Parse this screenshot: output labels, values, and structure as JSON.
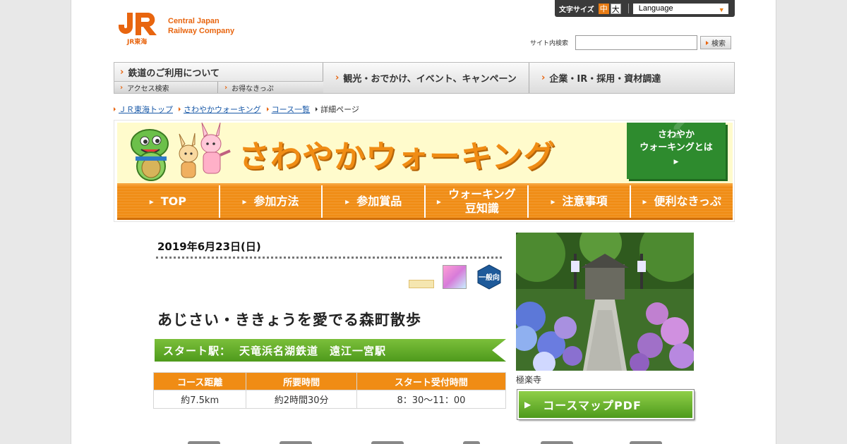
{
  "utility": {
    "text_size_label": "文字サイズ",
    "size_medium": "中",
    "size_large": "大",
    "language_select": "Language"
  },
  "logo": {
    "line1": "Central Japan",
    "line2": "Railway Company",
    "sub": "JR東海"
  },
  "search": {
    "label": "サイト内検索",
    "value": "",
    "button": "検索"
  },
  "global_nav": {
    "railway": "鉄道のご利用について",
    "access": "アクセス検索",
    "tickets": "お得なきっぷ",
    "tourism": "観光・おでかけ、イベント、キャンペーン",
    "corporate": "企業・IR・採用・資材調達"
  },
  "breadcrumb": {
    "items": [
      "ＪＲ東海トップ",
      "さわやかウォーキング",
      "コース一覧"
    ],
    "current": "詳細ページ"
  },
  "banner": {
    "title": "さわやかウォーキング",
    "about_line1": "さわやか",
    "about_line2": "ウォーキングとは",
    "about_arrow": "▲"
  },
  "sub_nav": {
    "items": [
      "TOP",
      "参加方法",
      "参加賞品",
      "ウォーキング豆知識",
      "注意事項",
      "便利なきっぷ"
    ]
  },
  "event": {
    "date": "2019年6月23日(日)",
    "course_title": "あじさい・ききょうを愛でる森町散歩",
    "start_label": "スタート駅：",
    "start_value": "天竜浜名湖鉄道　遠江一宮駅",
    "table_headers": [
      "コース距離",
      "所要時間",
      "スタート受付時間"
    ],
    "table_values": [
      "約7.5km",
      "約2時間30分",
      "8：30～11：00"
    ],
    "icon_level": "一般向",
    "photo_caption": "極楽寺",
    "pdf_button": "コースマップPDF"
  },
  "colors": {
    "orange": "#f08c14",
    "green": "#4e9a1c",
    "link": "#1a5aa8"
  }
}
